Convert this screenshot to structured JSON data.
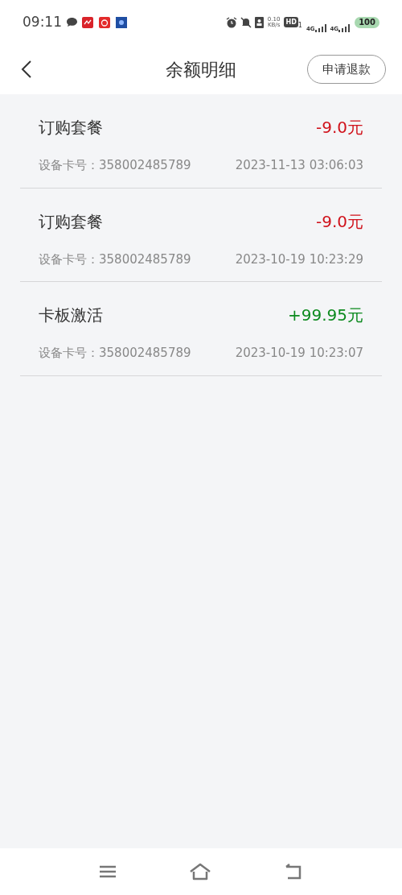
{
  "status_bar": {
    "time": "09:11",
    "net_speed": "0.10",
    "net_unit": "KB/s",
    "hd": "HD",
    "hd_sub": "1",
    "signal_1": "4G",
    "signal_2": "4G",
    "battery": "100"
  },
  "header": {
    "title": "余额明细",
    "action": "申请退款"
  },
  "records": [
    {
      "title": "订购套餐",
      "amount": "-9.0元",
      "kind": "debit",
      "card": "设备卡号：358002485789",
      "time": "2023-11-13 03:06:03"
    },
    {
      "title": "订购套餐",
      "amount": "-9.0元",
      "kind": "debit",
      "card": "设备卡号：358002485789",
      "time": "2023-10-19 10:23:29"
    },
    {
      "title": "卡板激活",
      "amount": "+99.95元",
      "kind": "credit",
      "card": "设备卡号：358002485789",
      "time": "2023-10-19 10:23:07"
    }
  ]
}
